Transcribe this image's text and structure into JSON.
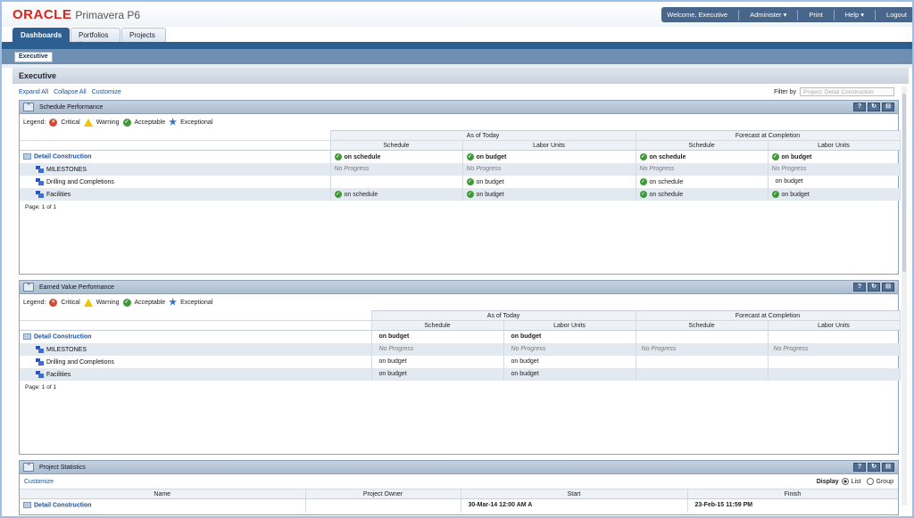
{
  "app": {
    "brand": "ORACLE",
    "product": "Primavera P6"
  },
  "topnav": {
    "welcome": "Welcome, Executive",
    "administer": "Administer ▾",
    "print": "Print",
    "help": "Help ▾",
    "logout": "Logout"
  },
  "tabs": {
    "dashboards": "Dashboards",
    "portfolios": "Portfolios ▾",
    "projects": "Projects"
  },
  "subtab": "Executive",
  "page_title": "Executive",
  "toolbar": {
    "expand_all": "Expand All",
    "collapse_all": "Collapse All",
    "customize": "Customize",
    "filter_label": "Filter by",
    "filter_value": "Project: Detail Construction"
  },
  "legend": {
    "label": "Legend:",
    "critical": "Critical",
    "warning": "Warning",
    "acceptable": "Acceptable",
    "exceptional": "Exceptional"
  },
  "colors": {
    "accent": "#2c5f90",
    "critical": "#d9472c",
    "warning": "#f2c400",
    "acceptable": "#3e9a35",
    "exceptional": "#2f74c8"
  },
  "headers": {
    "as_of_today": "As of Today",
    "forecast": "Forecast at Completion",
    "schedule": "Schedule",
    "labor_units": "Labor Units"
  },
  "schedule_perf": {
    "title": "Schedule Performance",
    "rows": [
      {
        "name": "Detail Construction",
        "c1": "on schedule",
        "c2": "on budget",
        "c3": "on schedule",
        "c4": "on budget"
      },
      {
        "name": "MILESTONES",
        "c1": "No Progress",
        "c2": "No Progress",
        "c3": "No Progress",
        "c4": "No Progress"
      },
      {
        "name": "Drilling and Completions",
        "c1": "",
        "c2": "on budget",
        "c3": "on schedule",
        "c4": "on budget"
      },
      {
        "name": "Facilities",
        "c1": "on schedule",
        "c2": "on budget",
        "c3": "on schedule",
        "c4": "on budget"
      }
    ],
    "pager": "Page: 1 of 1"
  },
  "earned_value": {
    "title": "Earned Value Performance",
    "rows": [
      {
        "name": "Detail Construction",
        "c1": "on budget",
        "c2": "on budget",
        "c3": "",
        "c4": ""
      },
      {
        "name": "MILESTONES",
        "c1": "No Progress",
        "c2": "No Progress",
        "c3": "No Progress",
        "c4": "No Progress"
      },
      {
        "name": "Drilling and Completions",
        "c1": "on budget",
        "c2": "on budget",
        "c3": "",
        "c4": ""
      },
      {
        "name": "Facilities",
        "c1": "on budget",
        "c2": "on budget",
        "c3": "",
        "c4": ""
      }
    ],
    "pager": "Page: 1 of 1"
  },
  "project_stats": {
    "title": "Project Statistics",
    "customize": "Customize",
    "display_label": "Display",
    "opt_list": "List",
    "opt_group": "Group",
    "columns": {
      "name": "Name",
      "owner": "Project Owner",
      "start": "Start",
      "finish": "Finish"
    },
    "row": {
      "name": "Detail Construction",
      "owner": "",
      "start": "30-Mar-14 12:00 AM A",
      "finish": "23-Feb-15 11:59 PM"
    }
  },
  "buttons": {
    "help": "?",
    "refresh": "↻",
    "restore": "⊟",
    "collapse": "⌃"
  }
}
